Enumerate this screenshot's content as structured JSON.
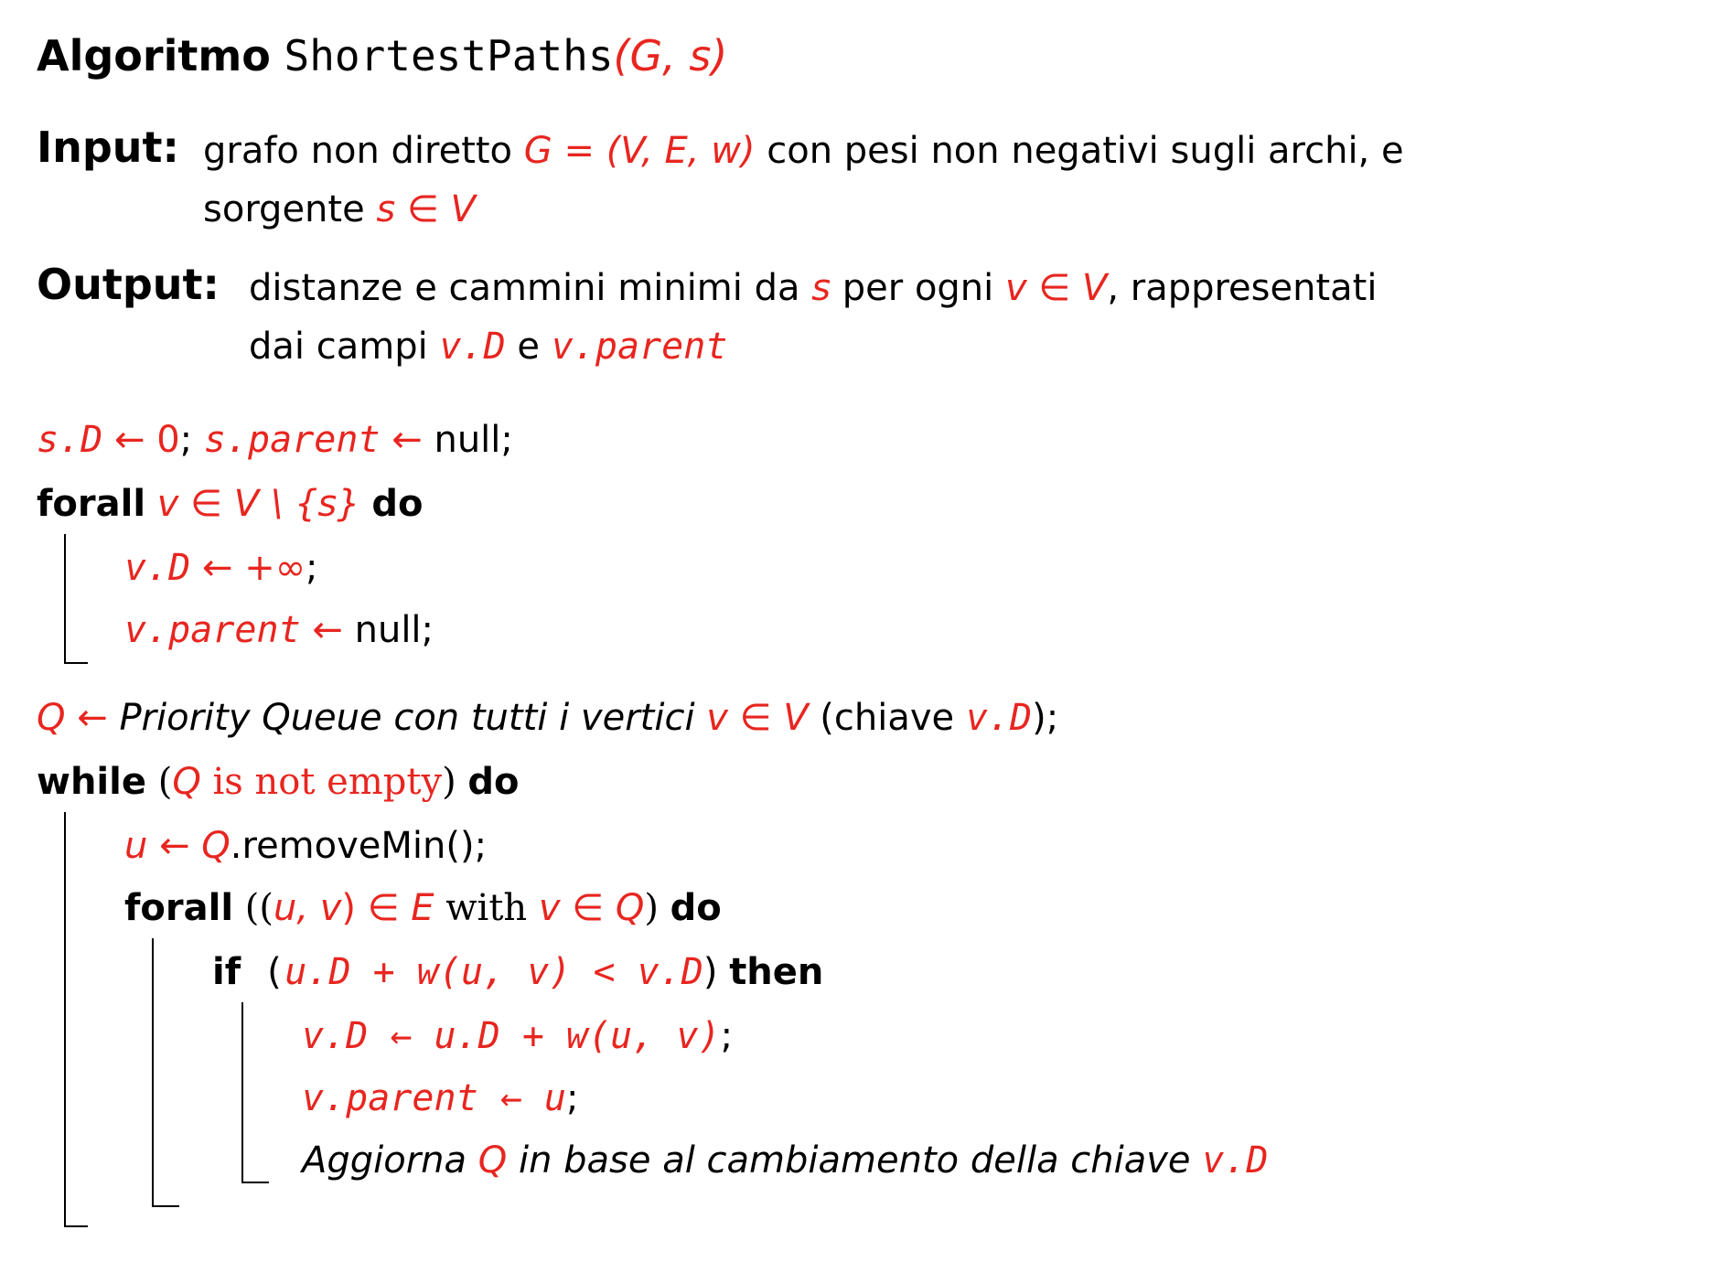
{
  "header": {
    "label": "Algoritmo",
    "name": "ShortestPaths",
    "params": "(G, s)"
  },
  "input": {
    "label": "Input:",
    "line1_a": "grafo non diretto",
    "line1_expr": "G = (V, E, w)",
    "line1_b": "con pesi non negativi sugli archi, e",
    "line2_a": "sorgente",
    "line2_expr": "s ∈ V"
  },
  "output": {
    "label": "Output:",
    "line1_a": "distanze e cammini minimi da",
    "line1_s": "s",
    "line1_b": "per ogni",
    "line1_expr": "v ∈ V",
    "line1_c": ", rappresentati",
    "line2_a": "dai campi",
    "line2_d": "v.D",
    "line2_e": "e",
    "line2_p": "v.parent"
  },
  "code": {
    "l1": {
      "a": "s.D",
      "b": " ← 0",
      "c": "; ",
      "d": "s.parent",
      "e": " ← ",
      "f": "null;"
    },
    "l2": {
      "kw": "forall",
      "expr": "v ∈ V \\ {s}",
      "kw2": "do"
    },
    "l3": {
      "a": "v.D",
      "b": " ← +∞",
      "c": ";"
    },
    "l4": {
      "a": "v.parent",
      "b": " ← ",
      "c": "null;"
    },
    "l5": {
      "a": "Q ←",
      "b": "Priority Queue con tutti i vertici",
      "c": "v ∈ V",
      "d": " (chiave ",
      "e": "v.D",
      "f": ");"
    },
    "l6": {
      "kw": "while",
      "open": " (",
      "q": "Q",
      "cond": " is not empty",
      "close": ")",
      "kw2": "do"
    },
    "l7": {
      "a": "u ← Q",
      "b": ".removeMin();"
    },
    "l8": {
      "kw": "forall",
      "open": " ((",
      "pair": "u, v",
      "close1": ")",
      "in": " ∈ E",
      "with": " with ",
      "cond": "v ∈ Q",
      "close": ")",
      "kw2": "do"
    },
    "l9": {
      "kw": "if",
      "open": " (",
      "cond": "u.D + w(u, v) < v.D",
      "close": ")",
      "kw2": "then"
    },
    "l10": {
      "a": "v.D ← u.D + w(u, v)",
      "b": ";"
    },
    "l11": {
      "a": "v.parent ← u",
      "b": ";"
    },
    "l12": {
      "a": "Aggiorna",
      "q": "Q",
      "b": "in base al cambiamento della chiave",
      "c": "v.D"
    }
  },
  "colors": {
    "accent": "#e8251f",
    "text": "#000000",
    "background": "#ffffff"
  }
}
